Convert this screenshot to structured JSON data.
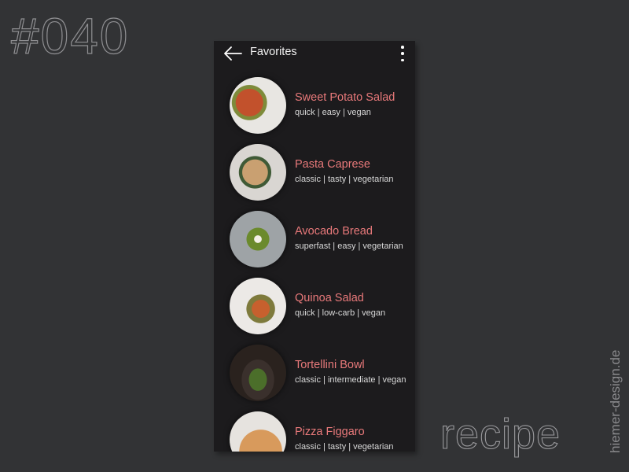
{
  "shot": {
    "number": "#040",
    "caption": "recipe",
    "credit": "hiemer-design.de"
  },
  "appbar": {
    "title": "Favorites",
    "back_icon": "arrow-left-icon",
    "menu_icon": "more-vertical-icon"
  },
  "colors": {
    "background": "#323335",
    "phone": "#1c1b1d",
    "accent": "#e8797a",
    "text": "#f2f2f2"
  },
  "recipes": [
    {
      "name": "Sweet Potato Salad",
      "tags": "quick | easy | vegan",
      "image": "sweet-potato-salad-photo"
    },
    {
      "name": "Pasta Caprese",
      "tags": "classic | tasty | vegetarian",
      "image": "pasta-caprese-photo"
    },
    {
      "name": "Avocado Bread",
      "tags": "superfast | easy | vegetarian",
      "image": "avocado-bread-photo"
    },
    {
      "name": "Quinoa Salad",
      "tags": "quick | low-carb | vegan",
      "image": "quinoa-salad-photo"
    },
    {
      "name": "Tortellini Bowl",
      "tags": "classic | intermediate | vegan",
      "image": "tortellini-bowl-photo"
    },
    {
      "name": "Pizza Figgaro",
      "tags": "classic | tasty | vegetarian",
      "image": "pizza-figgaro-photo"
    }
  ]
}
